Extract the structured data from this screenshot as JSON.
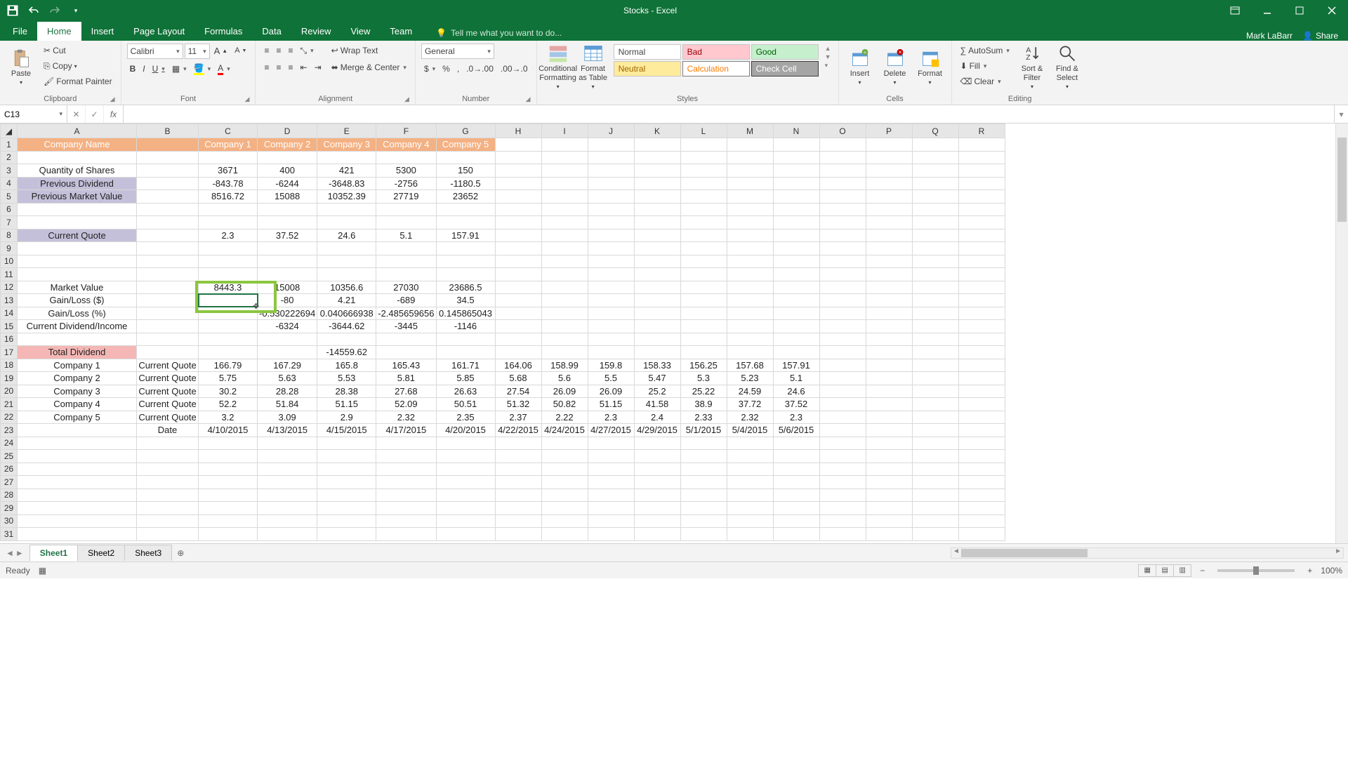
{
  "app": {
    "title": "Stocks - Excel",
    "user": "Mark LaBarr",
    "share": "Share"
  },
  "qat": {
    "save": "save",
    "undo": "undo",
    "redo": "redo"
  },
  "tabs": {
    "file": "File",
    "home": "Home",
    "insert": "Insert",
    "pagelayout": "Page Layout",
    "formulas": "Formulas",
    "data": "Data",
    "review": "Review",
    "view": "View",
    "team": "Team",
    "tellme": "Tell me what you want to do..."
  },
  "ribbon": {
    "clipboard": {
      "paste": "Paste",
      "cut": "Cut",
      "copy": "Copy",
      "formatpainter": "Format Painter",
      "label": "Clipboard"
    },
    "font": {
      "name": "Calibri",
      "size": "11",
      "label": "Font",
      "bold": "B",
      "italic": "I",
      "underline": "U"
    },
    "alignment": {
      "wrap": "Wrap Text",
      "merge": "Merge & Center",
      "label": "Alignment"
    },
    "number": {
      "format": "General",
      "label": "Number"
    },
    "styles": {
      "cond": "Conditional Formatting",
      "fat": "Format as Table",
      "s_normal": "Normal",
      "s_bad": "Bad",
      "s_good": "Good",
      "s_neutral": "Neutral",
      "s_calc": "Calculation",
      "s_check": "Check Cell",
      "label": "Styles"
    },
    "cells": {
      "insert": "Insert",
      "delete": "Delete",
      "format": "Format",
      "label": "Cells"
    },
    "editing": {
      "autosum": "AutoSum",
      "fill": "Fill",
      "clear": "Clear",
      "sort": "Sort & Filter",
      "find": "Find & Select",
      "label": "Editing"
    }
  },
  "fbar": {
    "name": "C13",
    "formula": ""
  },
  "columns": [
    "A",
    "B",
    "C",
    "D",
    "E",
    "F",
    "G",
    "H",
    "I",
    "J",
    "K",
    "L",
    "M",
    "N",
    "O",
    "P",
    "Q",
    "R"
  ],
  "headerRow": {
    "A": "Company Name",
    "C": "Company 1",
    "D": "Company 2",
    "E": "Company 3",
    "F": "Company 4",
    "G": "Company 5"
  },
  "rows": {
    "r3": {
      "A": "Quantity of Shares",
      "C": "3671",
      "D": "400",
      "E": "421",
      "F": "5300",
      "G": "150"
    },
    "r4": {
      "A": "Previous Dividend",
      "C": "-843.78",
      "D": "-6244",
      "E": "-3648.83",
      "F": "-2756",
      "G": "-1180.5"
    },
    "r5": {
      "A": "Previous Market Value",
      "C": "8516.72",
      "D": "15088",
      "E": "10352.39",
      "F": "27719",
      "G": "23652"
    },
    "r8": {
      "A": "Current Quote",
      "C": "2.3",
      "D": "37.52",
      "E": "24.6",
      "F": "5.1",
      "G": "157.91"
    },
    "r12": {
      "A": "Market Value",
      "C": "8443.3",
      "D": "15008",
      "E": "10356.6",
      "F": "27030",
      "G": "23686.5"
    },
    "r13": {
      "A": "Gain/Loss ($)",
      "D": "-80",
      "E": "4.21",
      "F": "-689",
      "G": "34.5"
    },
    "r14": {
      "A": "Gain/Loss (%)",
      "D": "-0.530222694",
      "E": "0.040666938",
      "F": "-2.485659656",
      "G": "0.145865043"
    },
    "r15": {
      "A": "Current Dividend/Income",
      "D": "-6324",
      "E": "-3644.62",
      "F": "-3445",
      "G": "-1146"
    },
    "r17": {
      "A": "Total Dividend",
      "E": "-14559.62"
    },
    "r18": {
      "A": "Company 1",
      "B": "Current Quote",
      "C": "166.79",
      "D": "167.29",
      "E": "165.8",
      "F": "165.43",
      "G": "161.71",
      "H": "164.06",
      "I": "158.99",
      "J": "159.8",
      "K": "158.33",
      "L": "156.25",
      "M": "157.68",
      "N": "157.91"
    },
    "r19": {
      "A": "Company 2",
      "B": "Current Quote",
      "C": "5.75",
      "D": "5.63",
      "E": "5.53",
      "F": "5.81",
      "G": "5.85",
      "H": "5.68",
      "I": "5.6",
      "J": "5.5",
      "K": "5.47",
      "L": "5.3",
      "M": "5.23",
      "N": "5.1"
    },
    "r20": {
      "A": "Company 3",
      "B": "Current Quote",
      "C": "30.2",
      "D": "28.28",
      "E": "28.38",
      "F": "27.68",
      "G": "26.63",
      "H": "27.54",
      "I": "26.09",
      "J": "26.09",
      "K": "25.2",
      "L": "25.22",
      "M": "24.59",
      "N": "24.6"
    },
    "r21": {
      "A": "Company 4",
      "B": "Current Quote",
      "C": "52.2",
      "D": "51.84",
      "E": "51.15",
      "F": "52.09",
      "G": "50.51",
      "H": "51.32",
      "I": "50.82",
      "J": "51.15",
      "K": "41.58",
      "L": "38.9",
      "M": "37.72",
      "N": "37.52"
    },
    "r22": {
      "A": "Company 5",
      "B": "Current Quote",
      "C": "3.2",
      "D": "3.09",
      "E": "2.9",
      "F": "2.32",
      "G": "2.35",
      "H": "2.37",
      "I": "2.22",
      "J": "2.3",
      "K": "2.4",
      "L": "2.33",
      "M": "2.32",
      "N": "2.3"
    },
    "r23": {
      "B": "Date",
      "C": "4/10/2015",
      "D": "4/13/2015",
      "E": "4/15/2015",
      "F": "4/17/2015",
      "G": "4/20/2015",
      "H": "4/22/2015",
      "I": "4/24/2015",
      "J": "4/27/2015",
      "K": "4/29/2015",
      "L": "5/1/2015",
      "M": "5/4/2015",
      "N": "5/6/2015"
    }
  },
  "sheets": {
    "s1": "Sheet1",
    "s2": "Sheet2",
    "s3": "Sheet3"
  },
  "status": {
    "ready": "Ready",
    "zoom": "100%"
  }
}
